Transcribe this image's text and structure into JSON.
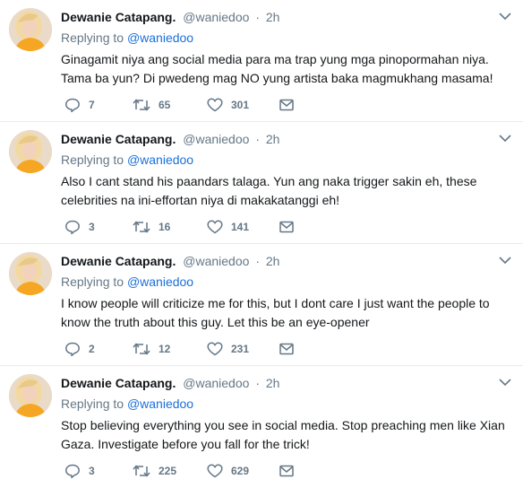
{
  "colors": {
    "name": "#14171a",
    "secondary": "#657786",
    "mention": "#1b6fd8",
    "divider": "#e6ecf0",
    "avatar_hair": "#f2d9a4",
    "avatar_top": "#f5a623"
  },
  "icons": {
    "reply": "reply-icon",
    "retweet": "retweet-icon",
    "like": "heart-icon",
    "dm": "envelope-icon",
    "menu": "chevron-down-icon"
  },
  "tweets": [
    {
      "name": "Dewanie Catapang.",
      "handle": "@waniedoo",
      "dot": "·",
      "time": "2h",
      "replying_prefix": "Replying to",
      "replying_mention": "@waniedoo",
      "text": "Ginagamit niya ang social media para ma trap yung mga pinopormahan niya. Tama ba yun? Di pwedeng mag NO yung artista baka magmukhang masama!",
      "replies": "7",
      "retweets": "65",
      "likes": "301"
    },
    {
      "name": "Dewanie Catapang.",
      "handle": "@waniedoo",
      "dot": "·",
      "time": "2h",
      "replying_prefix": "Replying to",
      "replying_mention": "@waniedoo",
      "text": "Also I cant stand his paandars talaga. Yun ang naka trigger sakin eh, these celebrities na ini-effortan niya di makakatanggi eh!",
      "replies": "3",
      "retweets": "16",
      "likes": "141"
    },
    {
      "name": "Dewanie Catapang.",
      "handle": "@waniedoo",
      "dot": "·",
      "time": "2h",
      "replying_prefix": "Replying to",
      "replying_mention": "@waniedoo",
      "text": "I know people will criticize me for this, but I dont care I just want the people to know the truth about this guy. Let this be an eye-opener",
      "replies": "2",
      "retweets": "12",
      "likes": "231"
    },
    {
      "name": "Dewanie Catapang.",
      "handle": "@waniedoo",
      "dot": "·",
      "time": "2h",
      "replying_prefix": "Replying to",
      "replying_mention": "@waniedoo",
      "text": "Stop believing everything you see in social media. Stop preaching men like Xian Gaza. Investigate before you fall for the trick!",
      "replies": "3",
      "retweets": "225",
      "likes": "629"
    }
  ]
}
